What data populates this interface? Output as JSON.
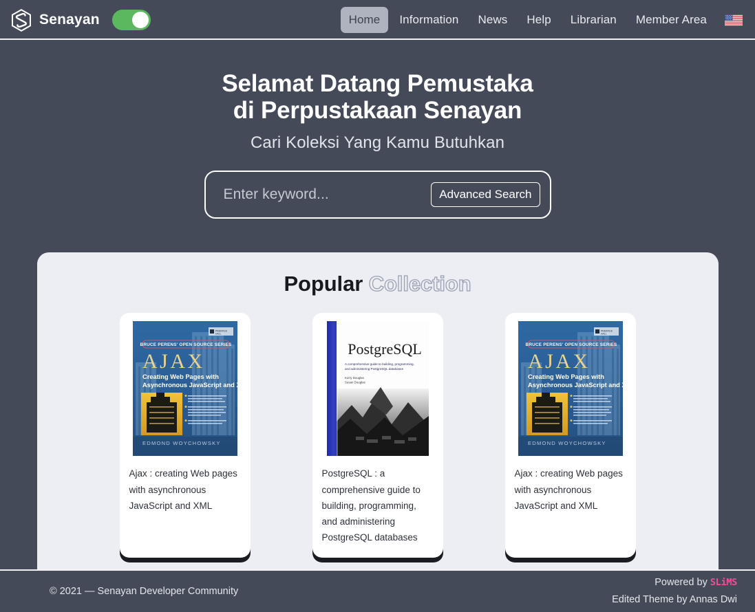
{
  "header": {
    "brand_name": "Senayan",
    "logo_icon": "hexagon-s-logo-icon",
    "theme_toggle": {
      "icon": "theme-toggle-switch",
      "state": "on",
      "on_color": "#5cb85f"
    },
    "nav_items": [
      {
        "label": "Home",
        "active": true
      },
      {
        "label": "Information",
        "active": false
      },
      {
        "label": "News",
        "active": false
      },
      {
        "label": "Help",
        "active": false
      },
      {
        "label": "Librarian",
        "active": false
      },
      {
        "label": "Member Area",
        "active": false
      }
    ],
    "language_flag": {
      "icon": "us-flag-icon",
      "label": "English"
    }
  },
  "hero": {
    "title_line1": "Selamat Datang Pemustaka",
    "title_line2": "di Perpustakaan Senayan",
    "subtitle": "Cari Koleksi Yang Kamu Butuhkan",
    "search": {
      "placeholder": "Enter keyword...",
      "value": "",
      "advanced_button": "Advanced Search"
    }
  },
  "collection": {
    "heading_solid": "Popular",
    "heading_outline": "Collection",
    "books": [
      {
        "title": "Ajax : creating Web pages with asynchronous JavaScript and XML",
        "cover": "ajax-book-cover",
        "cover_texts": {
          "publisher": "PRENTICE HALL",
          "series": "BRUCE PERENS' OPEN SOURCE SERIES",
          "main_title": "AJAX",
          "subtitle_line1": "Creating Web Pages with",
          "subtitle_line2": "Asynchronous JavaScript and XML",
          "author": "EDMOND WOYCHOWSKY"
        }
      },
      {
        "title": "PostgreSQL : a comprehensive guide to building, programming, and administering PostgreSQL databases",
        "cover": "postgresql-book-cover",
        "cover_texts": {
          "main_title": "PostgreSQL",
          "subtitle_line1": "A comprehensive guide to building, programming,",
          "subtitle_line2": "and administering PostgreSQL databases",
          "author_line1": "Korry Douglas",
          "author_line2": "Susan Douglas"
        }
      },
      {
        "title": "Ajax : creating Web pages with asynchronous JavaScript and XML",
        "cover": "ajax-book-cover",
        "cover_texts": {
          "publisher": "PRENTICE HALL",
          "series": "BRUCE PERENS' OPEN SOURCE SERIES",
          "main_title": "AJAX",
          "subtitle_line1": "Creating Web Pages with",
          "subtitle_line2": "Asynchronous JavaScript and XML",
          "author": "EDMOND WOYCHOWSKY"
        }
      }
    ]
  },
  "footer": {
    "copyright": "© 2021 — Senayan Developer Community",
    "powered_by_prefix": "Powered by ",
    "powered_by_name": "SLiMS",
    "theme_credit": "Edited Theme by Annas Dwi"
  },
  "colors": {
    "page_background": "#454a58",
    "panel_background": "#edeef3",
    "accent_green": "#5cb85f",
    "accent_pink": "#f0509a",
    "active_pill": "#aeb3bf"
  }
}
